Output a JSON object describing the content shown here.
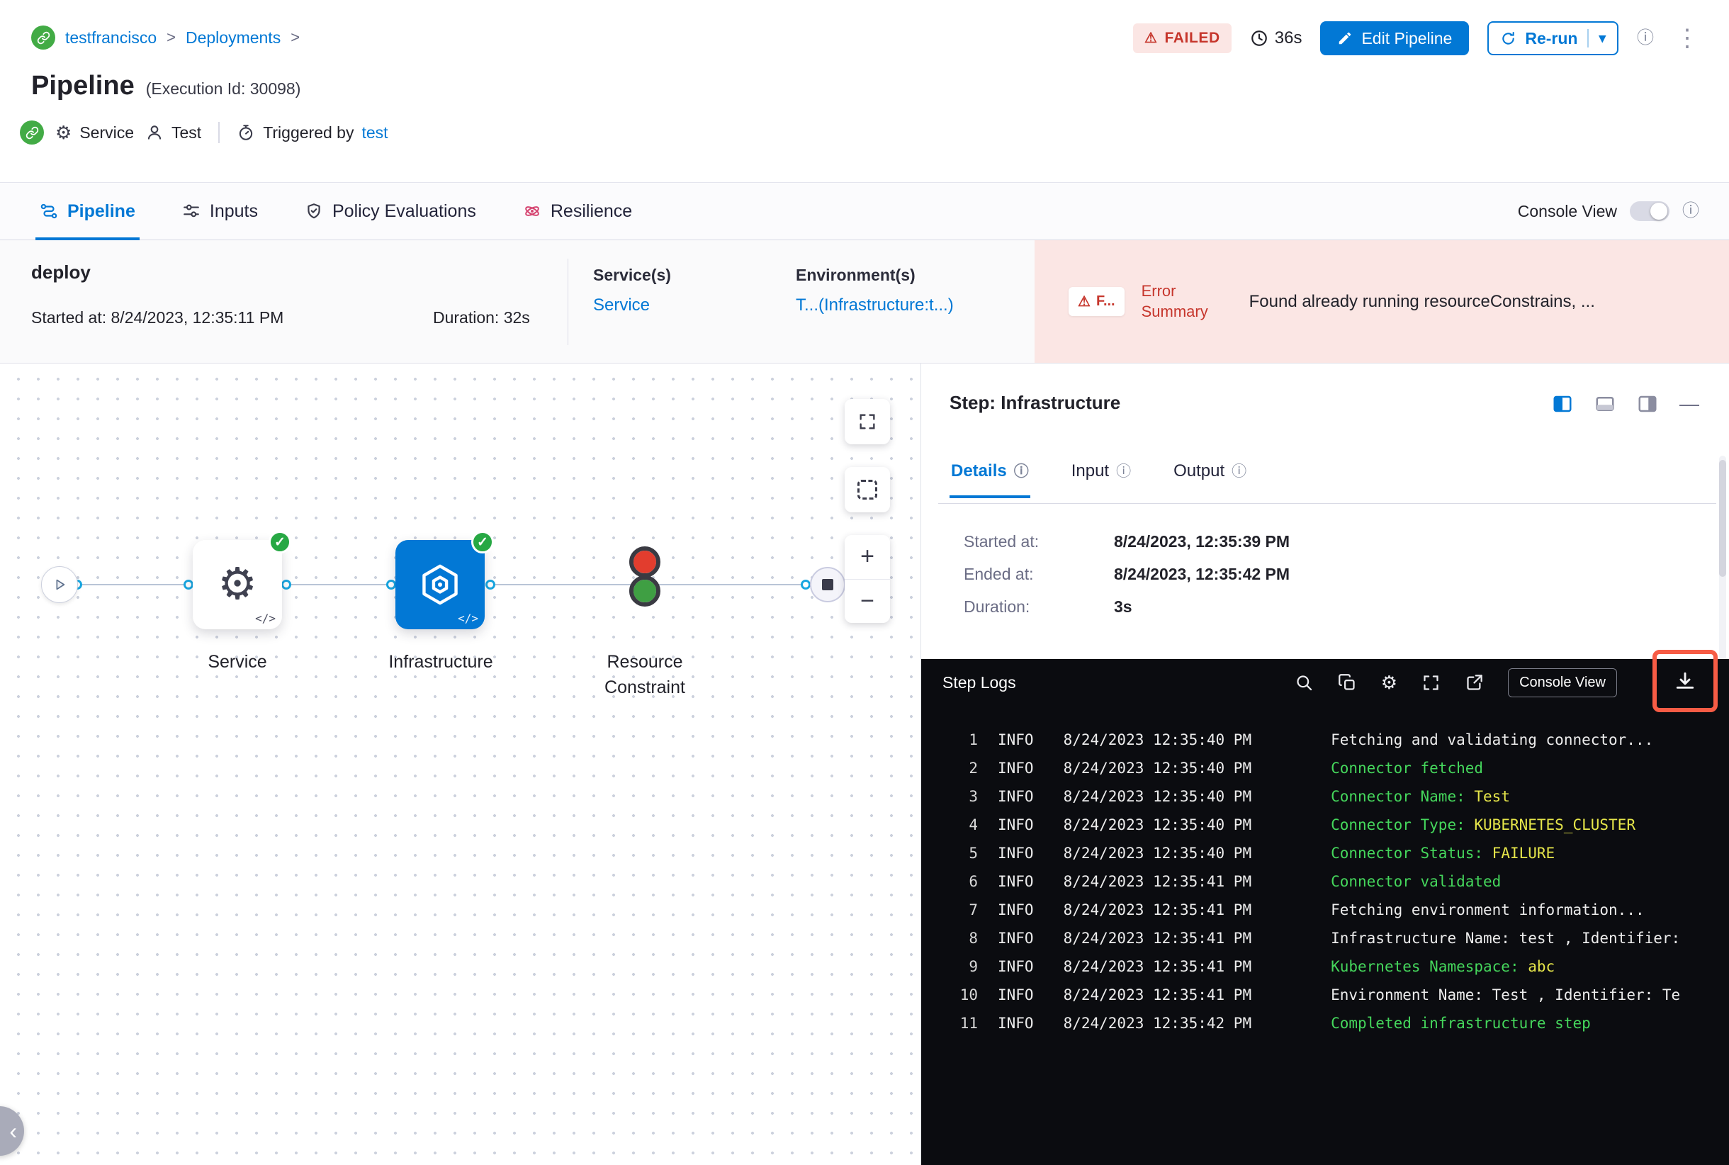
{
  "colors": {
    "accent": "#0278d5",
    "success": "#42ab45",
    "error": "#c6362c",
    "error_bg": "#fbe6e4",
    "log_green": "#45d75c",
    "log_yellow": "#e6e64a",
    "highlight_box": "#f75c45"
  },
  "icons": {
    "check": "✓",
    "more_vertical": "⋮",
    "plus": "+",
    "minus": "−",
    "chevron_left": "‹",
    "caret_down": "▾",
    "info": "ⓘ",
    "warning": "⚠",
    "gear": "⚙",
    "dash": "—"
  },
  "header": {
    "breadcrumb": {
      "project": "testfrancisco",
      "section": "Deployments",
      "separator": ">"
    },
    "status_badge": "FAILED",
    "elapsed": "36s",
    "edit_pipeline_button": "Edit Pipeline",
    "rerun_button": "Re-run",
    "title": "Pipeline",
    "execution_id": "(Execution Id: 30098)",
    "meta": {
      "service": "Service",
      "test": "Test",
      "triggered_by_label": "Triggered by",
      "triggered_by_value": "test"
    }
  },
  "tabbar": {
    "tabs": [
      {
        "label": "Pipeline"
      },
      {
        "label": "Inputs"
      },
      {
        "label": "Policy Evaluations"
      },
      {
        "label": "Resilience"
      }
    ],
    "console_view_label": "Console View"
  },
  "summary": {
    "stage_name": "deploy",
    "started": "Started at: 8/24/2023, 12:35:11 PM",
    "duration": "Duration: 32s",
    "services_label": "Service(s)",
    "services_value": "Service",
    "environments_label": "Environment(s)",
    "environments_value": "T...(Infrastructure:t...)",
    "error_badge": "F...",
    "error_summary_label": "Error Summary",
    "error_summary_text": "Found already running resourceConstrains, ..."
  },
  "graph": {
    "nodes": [
      {
        "label": "Service"
      },
      {
        "label": "Infrastructure"
      },
      {
        "label": "Resource Constraint"
      }
    ],
    "code_marker": "</>"
  },
  "step_panel": {
    "title": "Step: Infrastructure",
    "tabs": [
      {
        "label": "Details"
      },
      {
        "label": "Input"
      },
      {
        "label": "Output"
      }
    ],
    "details": [
      {
        "label": "Started at:",
        "value": "8/24/2023, 12:35:39 PM"
      },
      {
        "label": "Ended at:",
        "value": "8/24/2023, 12:35:42 PM"
      },
      {
        "label": "Duration:",
        "value": "3s"
      }
    ],
    "logs": {
      "title": "Step Logs",
      "console_view_button": "Console View",
      "lines": [
        {
          "num": "1",
          "level": "INFO",
          "time": "8/24/2023 12:35:40 PM",
          "parts": [
            {
              "t": "Fetching and validating connector...",
              "c": "default"
            }
          ]
        },
        {
          "num": "2",
          "level": "INFO",
          "time": "8/24/2023 12:35:40 PM",
          "parts": [
            {
              "t": "Connector fetched",
              "c": "green"
            }
          ]
        },
        {
          "num": "3",
          "level": "INFO",
          "time": "8/24/2023 12:35:40 PM",
          "parts": [
            {
              "t": "Connector Name: ",
              "c": "green"
            },
            {
              "t": "Test",
              "c": "yellow"
            }
          ]
        },
        {
          "num": "4",
          "level": "INFO",
          "time": "8/24/2023 12:35:40 PM",
          "parts": [
            {
              "t": "Connector Type: ",
              "c": "green"
            },
            {
              "t": "KUBERNETES_CLUSTER",
              "c": "yellow"
            }
          ]
        },
        {
          "num": "5",
          "level": "INFO",
          "time": "8/24/2023 12:35:40 PM",
          "parts": [
            {
              "t": "Connector Status: ",
              "c": "green"
            },
            {
              "t": "FAILURE",
              "c": "yellow"
            }
          ]
        },
        {
          "num": "6",
          "level": "INFO",
          "time": "8/24/2023 12:35:41 PM",
          "parts": [
            {
              "t": "Connector validated",
              "c": "green"
            }
          ]
        },
        {
          "num": "7",
          "level": "INFO",
          "time": "8/24/2023 12:35:41 PM",
          "parts": [
            {
              "t": "Fetching environment information...",
              "c": "default"
            }
          ]
        },
        {
          "num": "8",
          "level": "INFO",
          "time": "8/24/2023 12:35:41 PM",
          "parts": [
            {
              "t": "Infrastructure Name: test , Identifier:",
              "c": "default"
            }
          ]
        },
        {
          "num": "9",
          "level": "INFO",
          "time": "8/24/2023 12:35:41 PM",
          "parts": [
            {
              "t": "Kubernetes Namespace: ",
              "c": "green"
            },
            {
              "t": "abc",
              "c": "yellow"
            }
          ]
        },
        {
          "num": "10",
          "level": "INFO",
          "time": "8/24/2023 12:35:41 PM",
          "parts": [
            {
              "t": "Environment Name: Test , Identifier: Te",
              "c": "default"
            }
          ]
        },
        {
          "num": "11",
          "level": "INFO",
          "time": "8/24/2023 12:35:42 PM",
          "parts": [
            {
              "t": "Completed infrastructure step",
              "c": "green"
            }
          ]
        }
      ]
    }
  }
}
